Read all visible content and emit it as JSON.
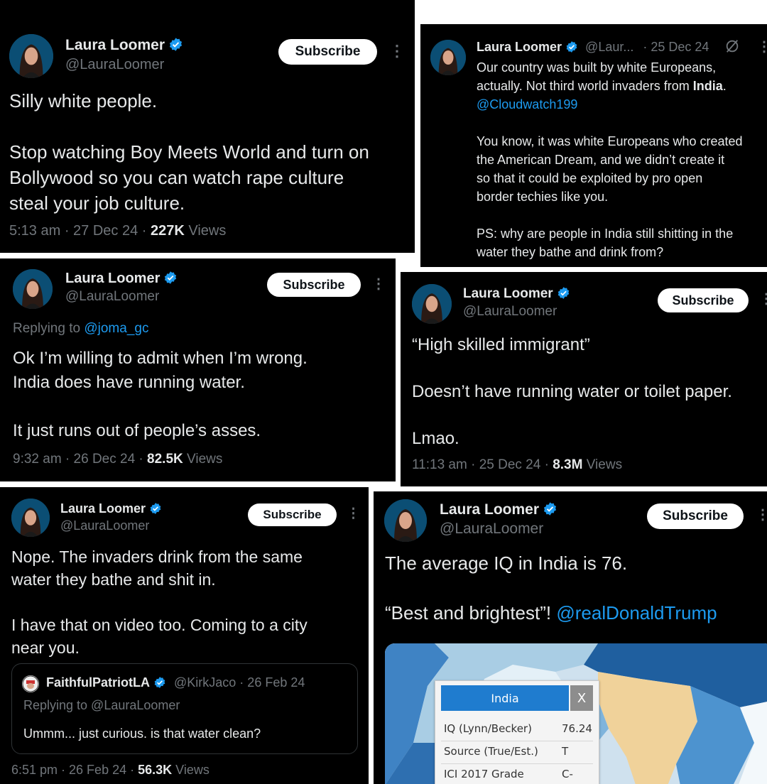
{
  "author": {
    "name": "Laura Loomer",
    "handle": "@LauraLoomer",
    "handle_truncated": "@Laur..."
  },
  "subscribe_label": "Subscribe",
  "more_icon": "⋮",
  "tweets": {
    "t1": {
      "lines": [
        "Silly white people.",
        "",
        "Stop watching Boy Meets World and turn on",
        "Bollywood so you can watch rape culture",
        "steal your job culture."
      ],
      "time": "5:13 am · 27 Dec 24 · ",
      "views_count": "227K",
      "views_label": " Views"
    },
    "t2": {
      "date": "· 25 Dec 24",
      "line1": "Our country was built by white Europeans,",
      "line2_pre": "actually. Not third world invaders from ",
      "line2_bold": "India",
      "line2_post": ".",
      "mention": "@Cloudwatch199",
      "para2": [
        "You know, it was white Europeans who created",
        "the American Dream, and we didn’t create it",
        "so that it could be exploited by pro open",
        "border techies like you."
      ],
      "para3": [
        "PS: why are people in India still shitting in the",
        "water they bathe and drink from?"
      ]
    },
    "t3": {
      "replying_label": "Replying to ",
      "replying_to": "@joma_gc",
      "lines": [
        "Ok I’m willing to admit when I’m wrong.",
        "India does have running water.",
        "",
        "It just runs out of people’s asses."
      ],
      "time": "9:32 am · 26 Dec 24 · ",
      "views_count": "82.5K",
      "views_label": " Views"
    },
    "t4": {
      "lines": [
        "“High skilled immigrant”",
        "",
        "Doesn’t have running water or toilet paper.",
        "",
        "Lmao."
      ],
      "time": "11:13 am · 25 Dec 24 · ",
      "views_count": "8.3M",
      "views_label": " Views"
    },
    "t5": {
      "lines": [
        "Nope. The invaders drink from the same",
        "water they bathe and shit in.",
        "",
        "I have that on video too. Coming to a city",
        "near you."
      ],
      "quote": {
        "name": "FaithfulPatriotLA",
        "handle": "@KirkJaco · 26 Feb 24",
        "replying": "Replying to @LauraLoomer",
        "text": "Ummm... just curious. is that water clean?"
      },
      "time": "6:51 pm · 26 Feb 24 · ",
      "views_count": "56.3K",
      "views_label": " Views"
    },
    "t6": {
      "line1": "The average IQ in India is 76.",
      "line2_pre": "“Best and brightest”! ",
      "line2_mention": "@realDonaldTrump",
      "map_popup": {
        "title": "India",
        "close": "X",
        "rows": [
          {
            "label": "IQ (Lynn/Becker)",
            "value": "76.24"
          },
          {
            "label": "Source (True/Est.)",
            "value": "T"
          },
          {
            "label": "ICI 2017 Grade",
            "value": "C-"
          }
        ]
      }
    }
  },
  "colors": {
    "background": "#000000",
    "text": "#e7e9ea",
    "muted": "#71767b",
    "link": "#1d9bf0",
    "verified": "#1d9bf0"
  }
}
